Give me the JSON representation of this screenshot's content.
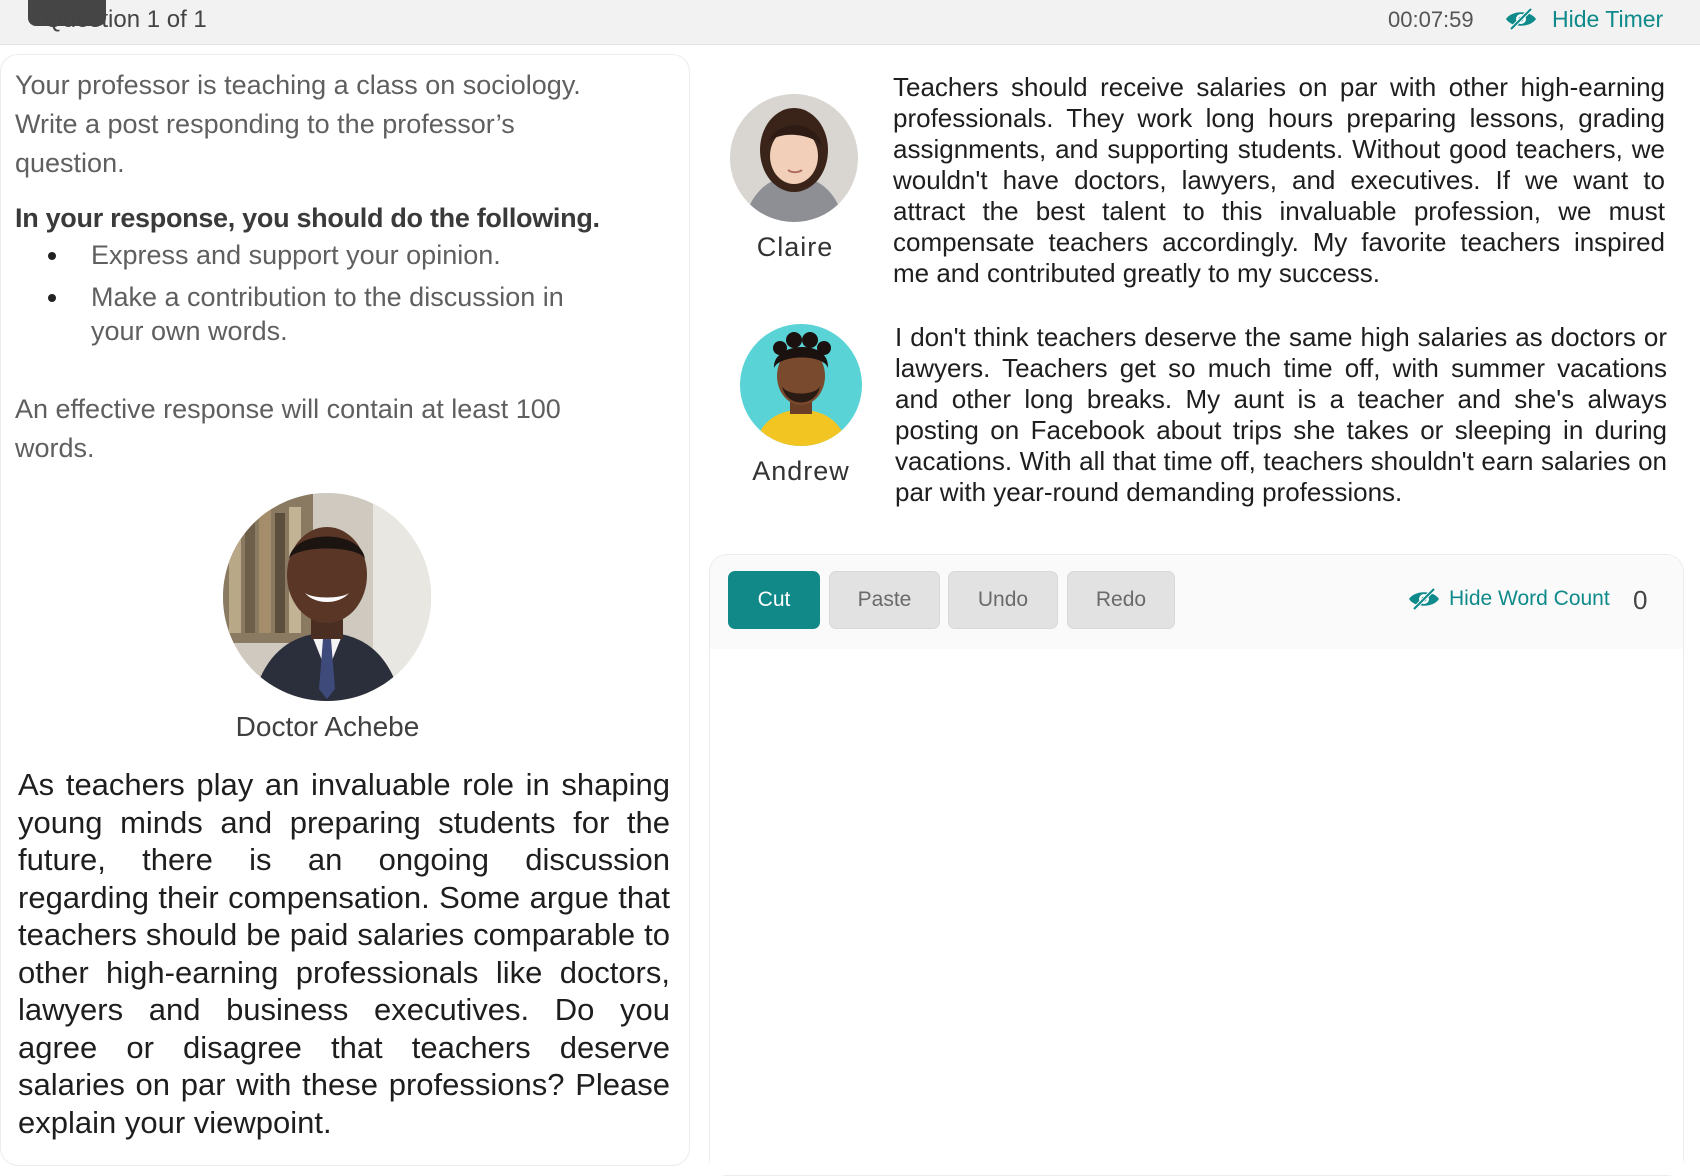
{
  "header": {
    "question_counter": "Question 1 of 1",
    "timer": "00:07:59",
    "hide_timer_label": "Hide Timer",
    "accent_color": "#0f8a8a"
  },
  "instructions": {
    "intro": "Your professor is teaching a class on sociology. Write a post responding to the professor’s question.",
    "heading": "In your response, you should do the following.",
    "bullets": [
      "Express and support your opinion.",
      "Make a contribution to the discussion in your own words."
    ],
    "length_note": "An effective response will contain at least 100 words."
  },
  "professor": {
    "name": "Doctor Achebe",
    "question": "As teachers play an invaluable role in shaping young minds and preparing students for the future, there is an ongoing discussion regarding their compensation. Some argue that teachers should be paid salaries comparable to other high-earning professionals like doctors, lawyers and business executives. Do you agree or disagree that teachers deserve salaries on par with these professions? Please explain your viewpoint."
  },
  "posts": [
    {
      "name": "Claire",
      "text": "Teachers should receive salaries on par with other high-earning professionals. They work long hours preparing lessons, grading assignments, and supporting students. Without good teachers, we wouldn't have doctors, lawyers, and executives. If we want to attract the best talent to this invaluable profession, we must compensate teachers accordingly. My favorite teachers inspired me and contributed greatly to my success."
    },
    {
      "name": "Andrew",
      "text": "I don't think teachers deserve the same high salaries as doctors or lawyers. Teachers get so much time off, with summer vacations and other long breaks. My aunt is a teacher and she's always posting on Facebook about trips she takes or sleeping in during vacations. With all that time off, teachers shouldn't earn salaries on par with year-round demanding professions."
    }
  ],
  "editor": {
    "buttons": {
      "cut": "Cut",
      "paste": "Paste",
      "undo": "Undo",
      "redo": "Redo"
    },
    "hide_word_count_label": "Hide Word Count",
    "word_count": "0",
    "response_text": ""
  }
}
